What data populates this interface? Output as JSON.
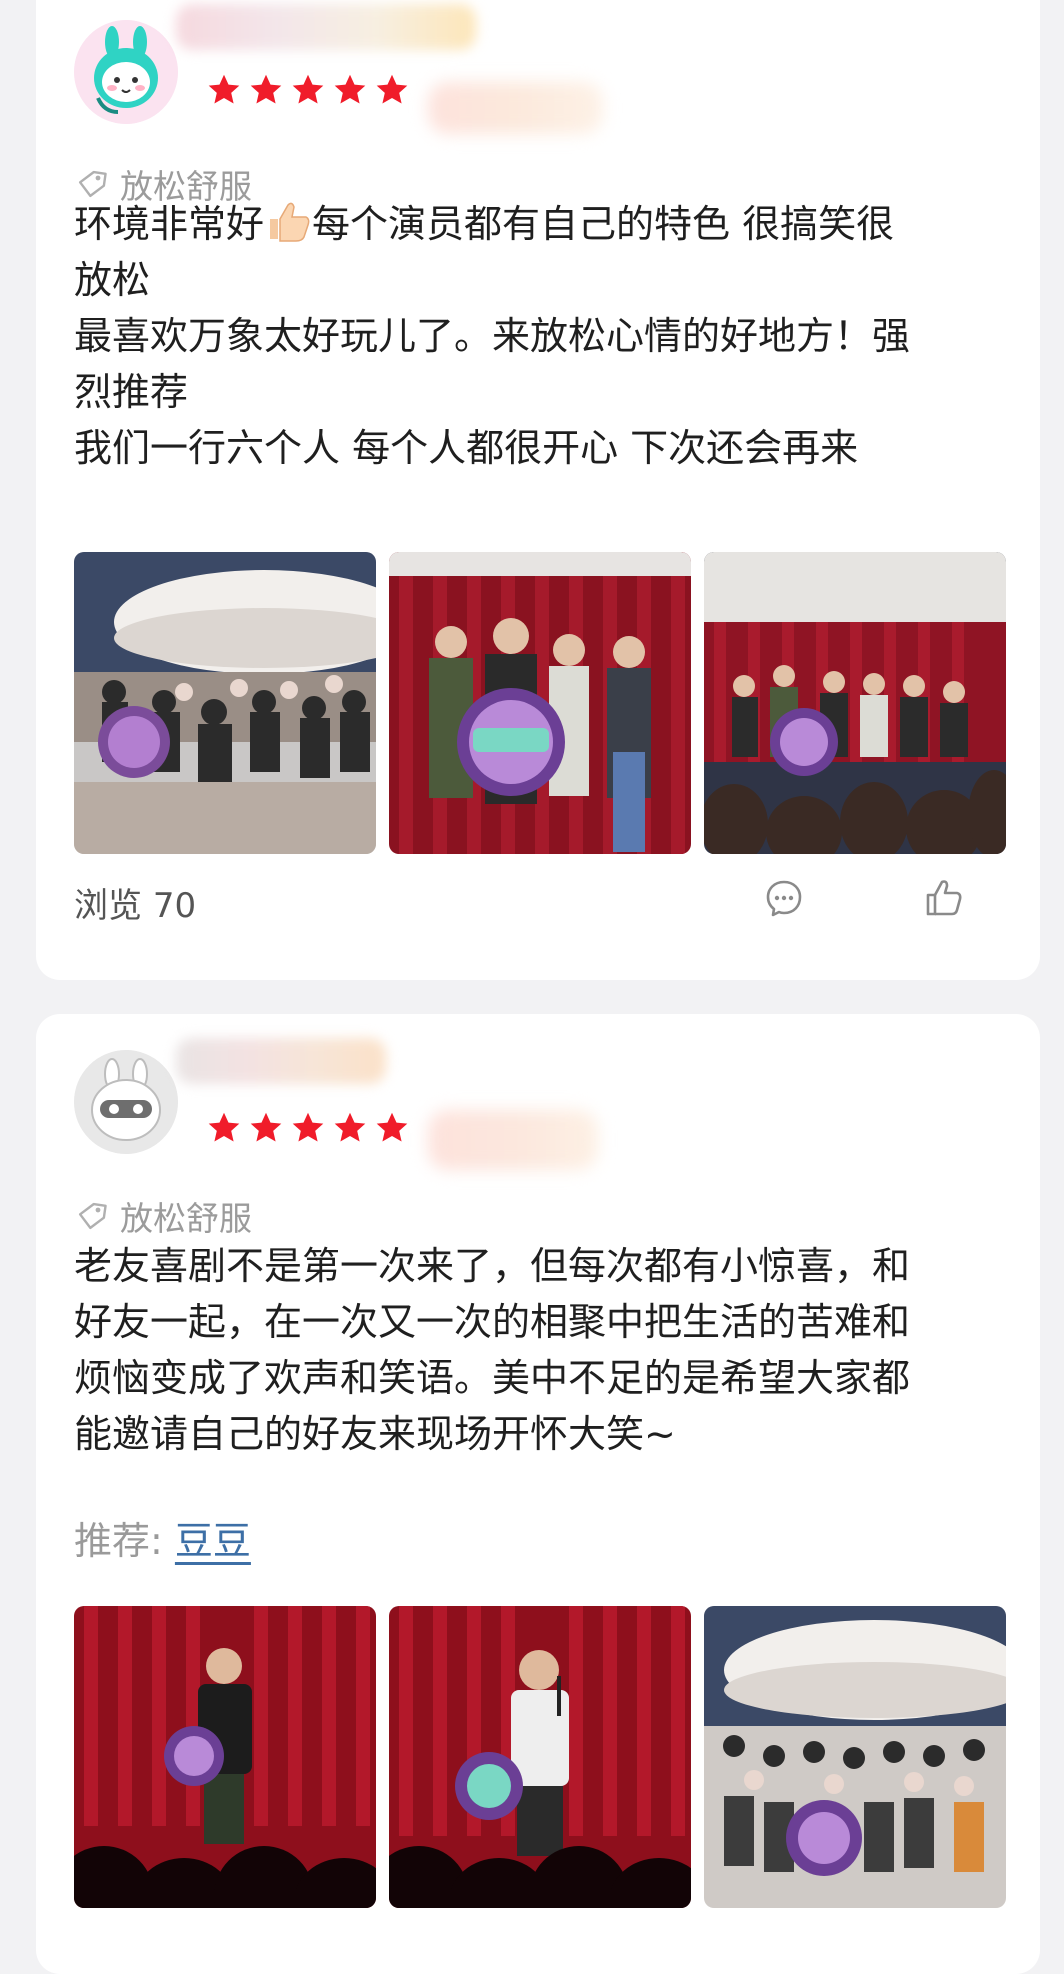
{
  "reviews": [
    {
      "tag": "放松舒服",
      "rating": 5,
      "text_lines": [
        "环境非常好",
        "每个演员都有自己的特色 很搞笑很",
        "放松",
        "最喜欢万象太好玩儿了。来放松心情的好地方！强",
        "烈推荐",
        "我们一行六个人 每个人都很开心 下次还会再来"
      ],
      "photos": [
        "audience-photo",
        "group-on-stage-photo",
        "stage-with-crowd-photo"
      ],
      "views_label": "浏览",
      "views_count": "70"
    },
    {
      "tag": "放松舒服",
      "rating": 5,
      "text_lines": [
        "老友喜剧不是第一次来了，但每次都有小惊喜，和",
        "好友一起，在一次又一次的相聚中把生活的苦难和",
        "烦恼变成了欢声和笑语。美中不足的是希望大家都",
        "能邀请自己的好友来现场开怀大笑~"
      ],
      "recommend_label": "推荐:",
      "recommend_item": "豆豆",
      "photos": [
        "comedian-on-stage-photo",
        "comedian-with-mic-photo",
        "audience-hall-photo"
      ]
    }
  ],
  "colors": {
    "star": "#f01c2a",
    "link": "#3d6fa6",
    "muted": "#9b9b9b"
  }
}
